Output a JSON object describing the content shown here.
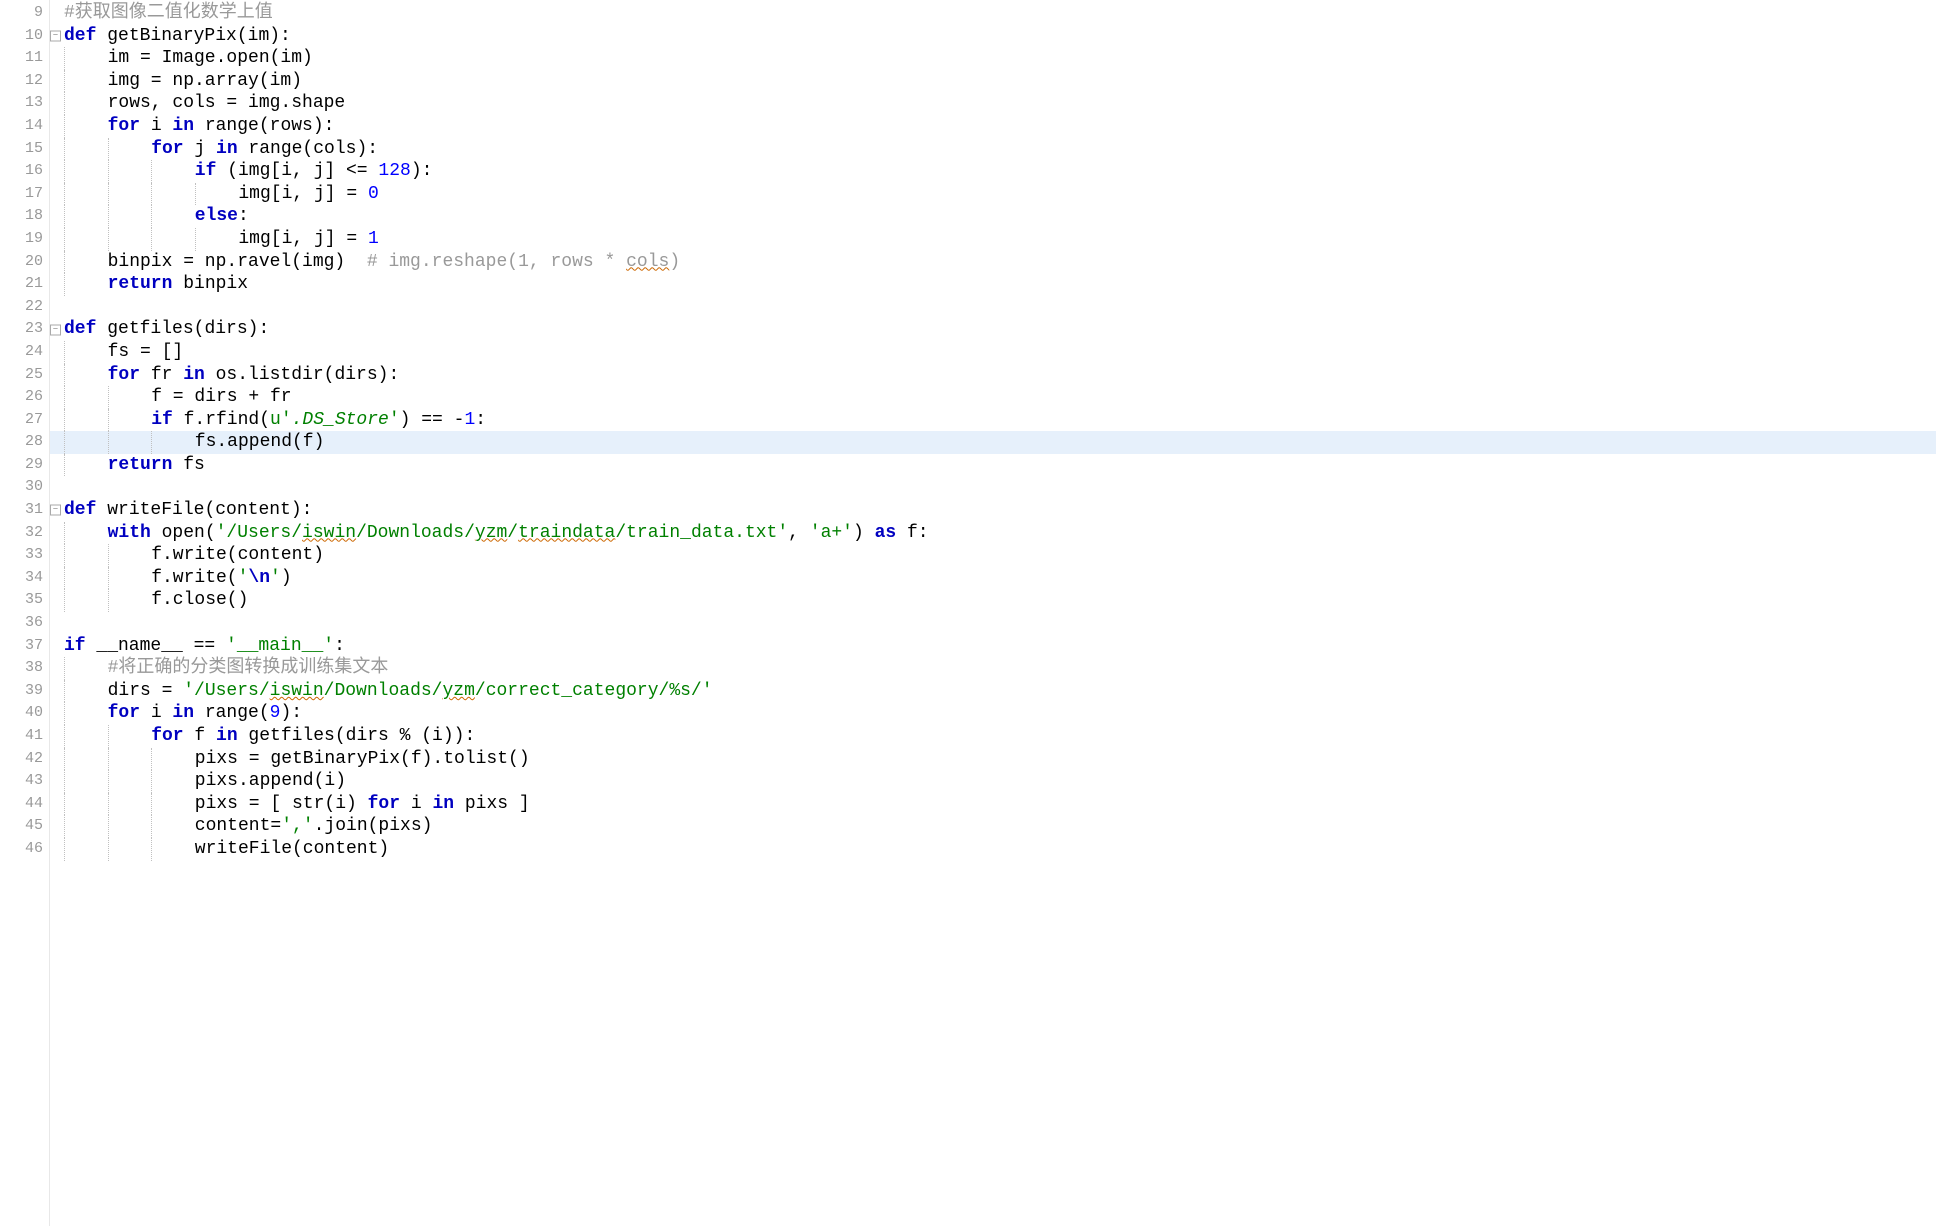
{
  "editor": {
    "startLine": 9,
    "highlightedLine": 28,
    "foldableLines": [
      10,
      23,
      31
    ],
    "lines": [
      {
        "n": 9,
        "tokens": [
          {
            "t": "#获取图像二值化数学上值",
            "c": "cmt"
          }
        ]
      },
      {
        "n": 10,
        "tokens": [
          {
            "t": "def ",
            "c": "kw"
          },
          {
            "t": "getBinaryPix",
            "c": "fn"
          },
          {
            "t": "(im):",
            "c": "op"
          }
        ]
      },
      {
        "n": 11,
        "indent": 1,
        "tokens": [
          {
            "t": "im = Image.open(im)",
            "c": "id"
          }
        ]
      },
      {
        "n": 12,
        "indent": 1,
        "tokens": [
          {
            "t": "img = np.array(im)",
            "c": "id"
          }
        ]
      },
      {
        "n": 13,
        "indent": 1,
        "tokens": [
          {
            "t": "rows, cols = img.shape",
            "c": "id"
          }
        ]
      },
      {
        "n": 14,
        "indent": 1,
        "tokens": [
          {
            "t": "for ",
            "c": "kw"
          },
          {
            "t": "i ",
            "c": "id"
          },
          {
            "t": "in ",
            "c": "kw"
          },
          {
            "t": "range(rows):",
            "c": "id"
          }
        ]
      },
      {
        "n": 15,
        "indent": 2,
        "tokens": [
          {
            "t": "for ",
            "c": "kw"
          },
          {
            "t": "j ",
            "c": "id"
          },
          {
            "t": "in ",
            "c": "kw"
          },
          {
            "t": "range(cols):",
            "c": "id"
          }
        ]
      },
      {
        "n": 16,
        "indent": 3,
        "tokens": [
          {
            "t": "if ",
            "c": "kw"
          },
          {
            "t": "(img[i, j] <= ",
            "c": "id"
          },
          {
            "t": "128",
            "c": "num"
          },
          {
            "t": "):",
            "c": "id"
          }
        ]
      },
      {
        "n": 17,
        "indent": 4,
        "tokens": [
          {
            "t": "img[i, j] = ",
            "c": "id"
          },
          {
            "t": "0",
            "c": "num"
          }
        ]
      },
      {
        "n": 18,
        "indent": 3,
        "tokens": [
          {
            "t": "else",
            "c": "kw"
          },
          {
            "t": ":",
            "c": "id"
          }
        ]
      },
      {
        "n": 19,
        "indent": 4,
        "tokens": [
          {
            "t": "img[i, j] = ",
            "c": "id"
          },
          {
            "t": "1",
            "c": "num"
          }
        ]
      },
      {
        "n": 20,
        "indent": 1,
        "tokens": [
          {
            "t": "binpix = np.ravel(img)  ",
            "c": "id"
          },
          {
            "t": "# img.reshape(1, rows * ",
            "c": "cmt"
          },
          {
            "t": "cols",
            "c": "cmt wavy"
          },
          {
            "t": ")",
            "c": "cmt"
          }
        ]
      },
      {
        "n": 21,
        "indent": 1,
        "tokens": [
          {
            "t": "return ",
            "c": "kw"
          },
          {
            "t": "binpix",
            "c": "id"
          }
        ]
      },
      {
        "n": 22,
        "tokens": []
      },
      {
        "n": 23,
        "tokens": [
          {
            "t": "def ",
            "c": "kw"
          },
          {
            "t": "getfiles",
            "c": "fn"
          },
          {
            "t": "(dirs):",
            "c": "op"
          }
        ]
      },
      {
        "n": 24,
        "indent": 1,
        "tokens": [
          {
            "t": "fs = []",
            "c": "id"
          }
        ]
      },
      {
        "n": 25,
        "indent": 1,
        "tokens": [
          {
            "t": "for ",
            "c": "kw"
          },
          {
            "t": "fr ",
            "c": "id"
          },
          {
            "t": "in ",
            "c": "kw"
          },
          {
            "t": "os.listdir(dirs):",
            "c": "id"
          }
        ]
      },
      {
        "n": 26,
        "indent": 2,
        "tokens": [
          {
            "t": "f = dirs + fr",
            "c": "id"
          }
        ]
      },
      {
        "n": 27,
        "indent": 2,
        "tokens": [
          {
            "t": "if ",
            "c": "kw"
          },
          {
            "t": "f.rfind(",
            "c": "id"
          },
          {
            "t": "u'",
            "c": "str"
          },
          {
            "t": ".DS_Store",
            "c": "stri"
          },
          {
            "t": "'",
            "c": "str"
          },
          {
            "t": ") == -",
            "c": "id"
          },
          {
            "t": "1",
            "c": "num"
          },
          {
            "t": ":",
            "c": "id"
          }
        ]
      },
      {
        "n": 28,
        "indent": 3,
        "tokens": [
          {
            "t": "fs.append(f)",
            "c": "id"
          }
        ]
      },
      {
        "n": 29,
        "indent": 1,
        "tokens": [
          {
            "t": "return ",
            "c": "kw"
          },
          {
            "t": "fs",
            "c": "id"
          }
        ]
      },
      {
        "n": 30,
        "tokens": []
      },
      {
        "n": 31,
        "tokens": [
          {
            "t": "def ",
            "c": "kw"
          },
          {
            "t": "writeFile",
            "c": "fn"
          },
          {
            "t": "(content):",
            "c": "op"
          }
        ]
      },
      {
        "n": 32,
        "indent": 1,
        "tokens": [
          {
            "t": "with ",
            "c": "kw"
          },
          {
            "t": "open(",
            "c": "id"
          },
          {
            "t": "'/Users/",
            "c": "str"
          },
          {
            "t": "iswin",
            "c": "stru"
          },
          {
            "t": "/Downloads/",
            "c": "str"
          },
          {
            "t": "yzm",
            "c": "stru"
          },
          {
            "t": "/",
            "c": "str"
          },
          {
            "t": "traindata",
            "c": "stru"
          },
          {
            "t": "/train_data.txt'",
            "c": "str"
          },
          {
            "t": ", ",
            "c": "id"
          },
          {
            "t": "'a+'",
            "c": "str"
          },
          {
            "t": ") ",
            "c": "id"
          },
          {
            "t": "as ",
            "c": "kw"
          },
          {
            "t": "f:",
            "c": "id"
          }
        ]
      },
      {
        "n": 33,
        "indent": 2,
        "tokens": [
          {
            "t": "f.write(content)",
            "c": "id"
          }
        ]
      },
      {
        "n": 34,
        "indent": 2,
        "tokens": [
          {
            "t": "f.write(",
            "c": "id"
          },
          {
            "t": "'",
            "c": "str"
          },
          {
            "t": "\\n",
            "c": "kw"
          },
          {
            "t": "'",
            "c": "str"
          },
          {
            "t": ")",
            "c": "id"
          }
        ]
      },
      {
        "n": 35,
        "indent": 2,
        "tokens": [
          {
            "t": "f.close()",
            "c": "id"
          }
        ]
      },
      {
        "n": 36,
        "tokens": []
      },
      {
        "n": 37,
        "tokens": [
          {
            "t": "if ",
            "c": "kw"
          },
          {
            "t": "__name__ == ",
            "c": "id"
          },
          {
            "t": "'__main__'",
            "c": "str"
          },
          {
            "t": ":",
            "c": "id"
          }
        ]
      },
      {
        "n": 38,
        "indent": 1,
        "tokens": [
          {
            "t": "#将正确的分类图转换成训练集文本",
            "c": "cmt"
          }
        ]
      },
      {
        "n": 39,
        "indent": 1,
        "tokens": [
          {
            "t": "dirs = ",
            "c": "id"
          },
          {
            "t": "'/Users/",
            "c": "str"
          },
          {
            "t": "iswin",
            "c": "stru"
          },
          {
            "t": "/Downloads/",
            "c": "str"
          },
          {
            "t": "yzm",
            "c": "stru"
          },
          {
            "t": "/correct_category/%s/'",
            "c": "str"
          }
        ]
      },
      {
        "n": 40,
        "indent": 1,
        "tokens": [
          {
            "t": "for ",
            "c": "kw"
          },
          {
            "t": "i ",
            "c": "id"
          },
          {
            "t": "in ",
            "c": "kw"
          },
          {
            "t": "range(",
            "c": "id"
          },
          {
            "t": "9",
            "c": "num"
          },
          {
            "t": "):",
            "c": "id"
          }
        ]
      },
      {
        "n": 41,
        "indent": 2,
        "tokens": [
          {
            "t": "for ",
            "c": "kw"
          },
          {
            "t": "f ",
            "c": "id"
          },
          {
            "t": "in ",
            "c": "kw"
          },
          {
            "t": "getfiles(dirs % (i)):",
            "c": "id"
          }
        ]
      },
      {
        "n": 42,
        "indent": 3,
        "tokens": [
          {
            "t": "pixs = getBinaryPix(f).tolist()",
            "c": "id"
          }
        ]
      },
      {
        "n": 43,
        "indent": 3,
        "tokens": [
          {
            "t": "pixs.append(i)",
            "c": "id"
          }
        ]
      },
      {
        "n": 44,
        "indent": 3,
        "tokens": [
          {
            "t": "pixs = [ str(i) ",
            "c": "id"
          },
          {
            "t": "for ",
            "c": "kw"
          },
          {
            "t": "i ",
            "c": "id"
          },
          {
            "t": "in ",
            "c": "kw"
          },
          {
            "t": "pixs ]",
            "c": "id"
          }
        ]
      },
      {
        "n": 45,
        "indent": 3,
        "tokens": [
          {
            "t": "content=",
            "c": "id"
          },
          {
            "t": "','",
            "c": "str"
          },
          {
            "t": ".join(pixs)",
            "c": "id"
          }
        ]
      },
      {
        "n": 46,
        "indent": 3,
        "tokens": [
          {
            "t": "writeFile(content)",
            "c": "id"
          }
        ]
      }
    ]
  }
}
